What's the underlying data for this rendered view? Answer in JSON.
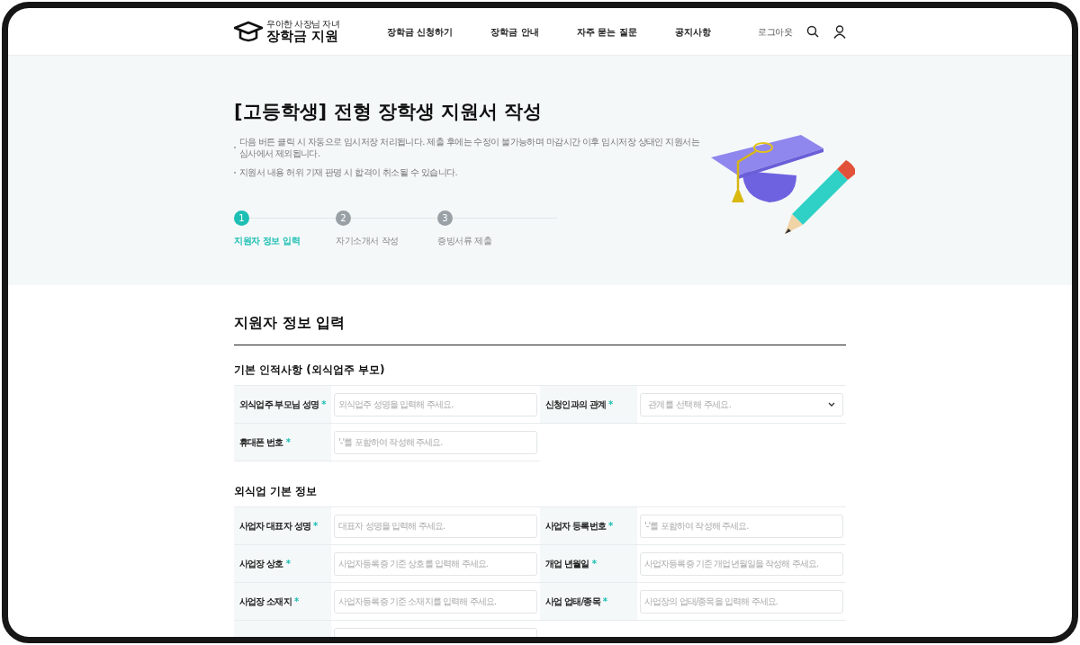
{
  "header": {
    "logo_tagline": "우아한 사장님 자녀",
    "logo_title": "장학금 지원",
    "nav": [
      {
        "label": "장학금 신청하기"
      },
      {
        "label": "장학금 안내"
      },
      {
        "label": "자주 묻는 질문"
      },
      {
        "label": "공지사항"
      }
    ],
    "logout": "로그아웃"
  },
  "hero": {
    "title": "[고등학생] 전형 장학생 지원서 작성",
    "notes": [
      "다음 버튼 클릭 시 자동으로 임시저장 처리됩니다. 제출 후에는 수정이 불가능하며 마감시간 이후 임시저장 상태인 지원서는 심사에서 제외됩니다.",
      "지원서 내용 허위 기재 판명 시 합격이 취소될 수 있습니다."
    ],
    "steps": [
      {
        "number": "1",
        "label": "지원자 정보 입력",
        "selected": true
      },
      {
        "number": "2",
        "label": "자기소개서 작성",
        "selected": false
      },
      {
        "number": "3",
        "label": "증빙서류 제출",
        "selected": false
      }
    ]
  },
  "form": {
    "title": "지원자 정보 입력",
    "sections": [
      {
        "title": "기본 인적사항 (외식업주 부모)",
        "fields": [
          {
            "label": "외식업주 부모님 성명",
            "mark": "*",
            "kind": "text",
            "placeholder": "외식업주 성명을 입력해 주세요."
          },
          {
            "label": "신청인과의 관계",
            "mark": "*",
            "kind": "select",
            "placeholder": "관계를 선택해 주세요."
          },
          {
            "label": "휴대폰 번호",
            "mark": "*",
            "kind": "text",
            "placeholder": "'-'를 포함하여 작성해 주세요."
          }
        ]
      },
      {
        "title": "외식업 기본 정보",
        "fields": [
          {
            "label": "사업자 대표자 성명",
            "mark": "*",
            "kind": "text",
            "placeholder": "대표자 성명을 입력해 주세요."
          },
          {
            "label": "사업자 등록번호",
            "mark": "*",
            "kind": "text",
            "placeholder": "'-'를 포함하여 작성해 주세요."
          },
          {
            "label": "사업장 상호",
            "mark": "*",
            "kind": "text",
            "placeholder": "사업자등록증 기준 상호를 입력해 주세요."
          },
          {
            "label": "개업 년월일",
            "mark": "*",
            "kind": "text",
            "placeholder": "사업자등록증 기준 개업년월일을 작성해 주세요."
          },
          {
            "label": "사업장 소재지",
            "mark": "*",
            "kind": "text",
            "placeholder": "사업자등록증 기준 소재지를 입력해 주세요."
          },
          {
            "label": "사업 업태/종목",
            "mark": "*",
            "kind": "text",
            "placeholder": "사업장의 업태/종목을 입력해 주세요."
          },
          {
            "kind": "text"
          }
        ]
      }
    ]
  }
}
